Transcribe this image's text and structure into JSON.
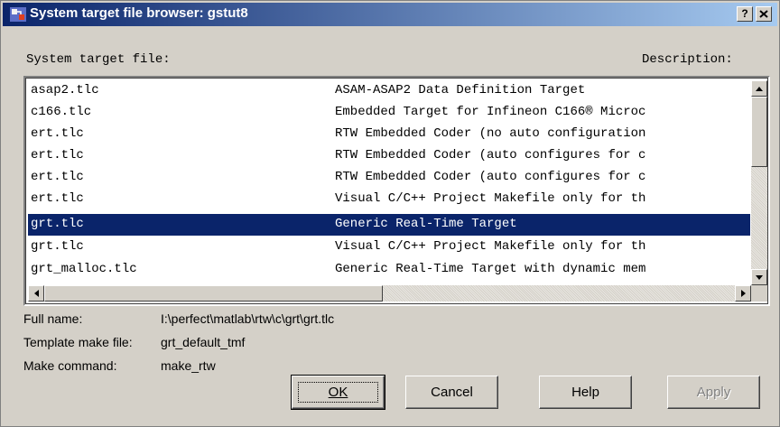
{
  "window": {
    "title": "System target file browser: gstut8",
    "help_label": "?",
    "close_label": "X"
  },
  "list": {
    "header_file": "System target file:",
    "header_desc": "Description:",
    "rows": [
      {
        "file": "asap2.tlc",
        "desc": "ASAM-ASAP2 Data Definition Target"
      },
      {
        "file": "c166.tlc",
        "desc": "Embedded Target for Infineon C166® Microc"
      },
      {
        "file": "ert.tlc",
        "desc": "RTW Embedded Coder (no auto configuration"
      },
      {
        "file": "ert.tlc",
        "desc": "RTW Embedded Coder (auto configures for c"
      },
      {
        "file": "ert.tlc",
        "desc": "RTW Embedded Coder (auto configures for c"
      },
      {
        "file": "ert.tlc",
        "desc": "Visual C/C++ Project Makefile only for th"
      },
      {
        "file": "grt.tlc",
        "desc": "Generic Real-Time Target",
        "selected": true
      },
      {
        "file": "grt.tlc",
        "desc": "Visual C/C++ Project Makefile only for th"
      },
      {
        "file": "grt_malloc.tlc",
        "desc": "Generic Real-Time Target with dynamic mem"
      }
    ]
  },
  "info": {
    "full_name_label": "Full name:",
    "full_name_value": "I:\\perfect\\matlab\\rtw\\c\\grt\\grt.tlc",
    "template_label": "Template make file:",
    "template_value": "grt_default_tmf",
    "make_label": "Make command:",
    "make_value": "make_rtw"
  },
  "buttons": {
    "ok": "OK",
    "cancel": "Cancel",
    "help": "Help",
    "apply": "Apply"
  },
  "colors": {
    "selection": "#0a246a",
    "face": "#d4d0c8",
    "title_gradient_start": "#0a246a",
    "title_gradient_end": "#a6caf0"
  }
}
